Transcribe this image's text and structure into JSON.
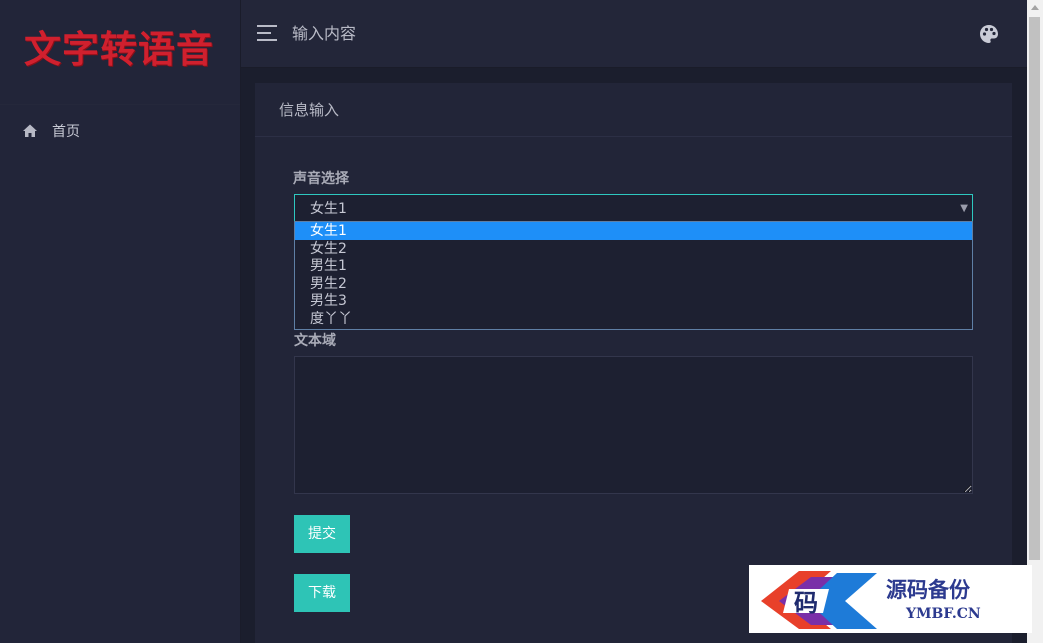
{
  "sidebar": {
    "logo_text": "文字转语音",
    "items": [
      {
        "label": "首页",
        "icon": "home-icon"
      }
    ]
  },
  "topbar": {
    "title": "输入内容",
    "menu_icon": "hamburger-icon",
    "theme_icon": "palette-icon"
  },
  "card": {
    "title": "信息输入"
  },
  "form": {
    "voice_label": "声音选择",
    "voice_selected": "女生1",
    "voice_options": [
      "女生1",
      "女生2",
      "男生1",
      "男生2",
      "男生3",
      "度丫丫"
    ],
    "textarea_label": "文本域",
    "textarea_value": "",
    "submit_label": "提交",
    "download_label": "下载"
  },
  "watermark": {
    "chinese_text": "源码备份",
    "english_text": "YMBF.CN"
  },
  "colors": {
    "accent": "#2ec4b6",
    "logo": "#d0202e",
    "selected_option": "#1e8ff8",
    "background": "#1b1e2d",
    "panel": "#222538"
  }
}
